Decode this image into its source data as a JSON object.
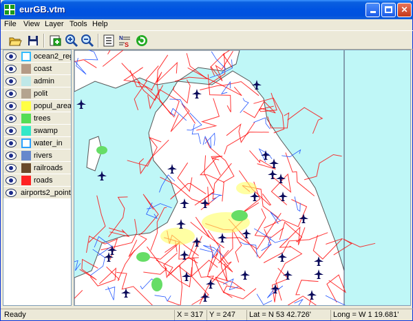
{
  "window": {
    "title": "eurGB.vtm"
  },
  "menu": [
    "File",
    "View",
    "Layer",
    "Tools",
    "Help"
  ],
  "toolbar": {
    "items": [
      "open-folder-icon",
      "save-icon",
      "add-layer-icon",
      "zoom-in-icon",
      "zoom-out-icon",
      "layer-list-icon",
      "nts-icon",
      "refresh-icon"
    ]
  },
  "layers": [
    {
      "name": "ocean2_reg",
      "color": "#33bbff"
    },
    {
      "name": "coast",
      "color": "#b49a86"
    },
    {
      "name": "admin",
      "color": "#bfe8e8"
    },
    {
      "name": "polit",
      "color": "#b4a48f"
    },
    {
      "name": "popul_areas",
      "color": "#ffff44"
    },
    {
      "name": "trees",
      "color": "#55dd55"
    },
    {
      "name": "swamp",
      "color": "#33e8c8"
    },
    {
      "name": "water_in",
      "color": "#2aa0ff"
    },
    {
      "name": "rivers",
      "color": "#6688cc"
    },
    {
      "name": "railroads",
      "color": "#6a4a2a"
    },
    {
      "name": "roads",
      "color": "#ff2222"
    },
    {
      "name": "airports2_point",
      "color": ""
    }
  ],
  "status": {
    "ready": "Ready",
    "x": "X = 317",
    "y": "Y = 247",
    "lat": "Lat = N 53 42.726'",
    "long": "Long = W 1 19.681'"
  },
  "map_colors": {
    "sea": "#bff7f7",
    "land": "#ffffff",
    "roads": "#ff0000",
    "rivers": "#2255ff",
    "airports": "#0a0a5a"
  }
}
